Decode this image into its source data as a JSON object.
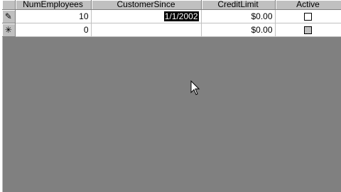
{
  "columns": {
    "num_employees": "NumEmployees",
    "customer_since": "CustomerSince",
    "credit_limit": "CreditLimit",
    "active": "Active"
  },
  "rows": [
    {
      "selector_icon": "pencil-edit-icon",
      "selector_glyph": "✎",
      "num_employees": "10",
      "customer_since": "1/1/2002",
      "credit_limit": "$0.00",
      "active": false
    },
    {
      "selector_icon": "new-record-icon",
      "selector_glyph": "✳",
      "num_employees": "0",
      "customer_since": "",
      "credit_limit": "$0.00",
      "active": null
    }
  ]
}
